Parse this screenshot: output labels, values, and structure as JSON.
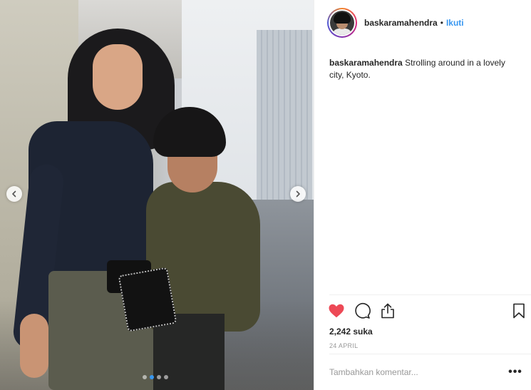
{
  "post": {
    "username": "baskaramahendra",
    "separator": "•",
    "follow_label": "Ikuti",
    "caption": {
      "username": "baskaramahendra",
      "text": "Strolling around in a lovely city, Kyoto."
    },
    "likes_text": "2,242 suka",
    "date_text": "24 APRIL",
    "comment_placeholder": "Tambahkan komentar...",
    "more_options": "•••",
    "liked": true,
    "heart_color": "#ed4956",
    "accent_color": "#3897f0"
  },
  "carousel": {
    "slide_count": 4,
    "active_index": 1,
    "prev_icon": "chevron-left-icon",
    "next_icon": "chevron-right-icon"
  },
  "actions": {
    "like_icon": "heart-filled-icon",
    "comment_icon": "comment-bubble-icon",
    "share_icon": "share-upload-icon",
    "save_icon": "bookmark-icon"
  }
}
